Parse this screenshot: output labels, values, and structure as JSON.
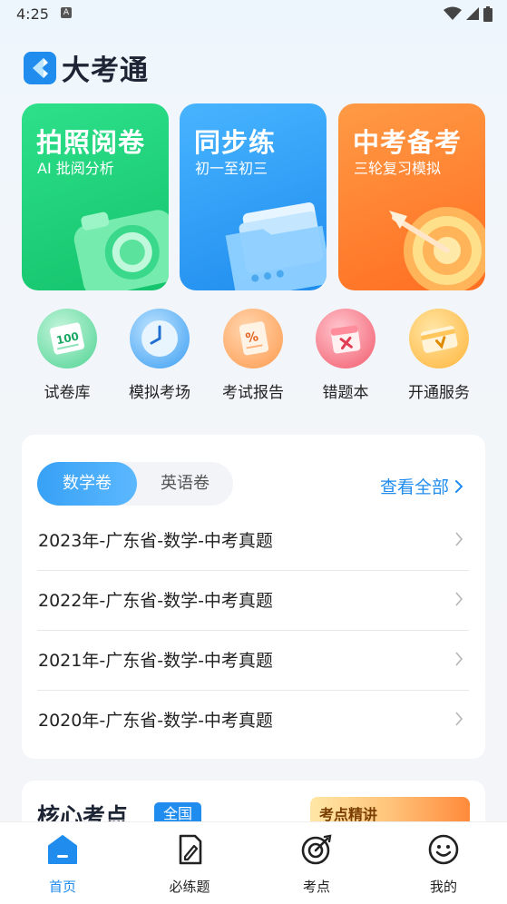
{
  "status_bar": {
    "time": "4:25",
    "notification_icon": "A"
  },
  "app": {
    "name": "大考通"
  },
  "feature_cards": [
    {
      "title": "拍照阅卷",
      "subtitle": "AI 批阅分析"
    },
    {
      "title": "同步练",
      "subtitle": "初一至初三"
    },
    {
      "title": "中考备考",
      "subtitle": "三轮复习模拟"
    }
  ],
  "quick_actions": [
    {
      "label": "试卷库",
      "icon": "paper-100-icon"
    },
    {
      "label": "模拟考场",
      "icon": "clock-icon"
    },
    {
      "label": "考试报告",
      "icon": "report-icon"
    },
    {
      "label": "错题本",
      "icon": "calendar-x-icon"
    },
    {
      "label": "开通服务",
      "icon": "vip-card-icon"
    }
  ],
  "exam_panel": {
    "tabs": [
      "数学卷",
      "英语卷"
    ],
    "active_tab": "数学卷",
    "view_all": "查看全部",
    "items": [
      "2023年-广东省-数学-中考真题",
      "2022年-广东省-数学-中考真题",
      "2021年-广东省-数学-中考真题",
      "2020年-广东省-数学-中考真题"
    ]
  },
  "core_panel": {
    "title": "核心考点",
    "badge": "全国",
    "tag": "考点精讲"
  },
  "bottom_nav": [
    {
      "label": "首页",
      "icon": "home-icon",
      "active": true
    },
    {
      "label": "必练题",
      "icon": "practice-icon",
      "active": false
    },
    {
      "label": "考点",
      "icon": "target-icon",
      "active": false
    },
    {
      "label": "我的",
      "icon": "smile-icon",
      "active": false
    }
  ],
  "colors": {
    "accent": "#1f8cee",
    "green": "#1fc872",
    "blue": "#2d9cf4",
    "orange": "#ff7d2b"
  }
}
